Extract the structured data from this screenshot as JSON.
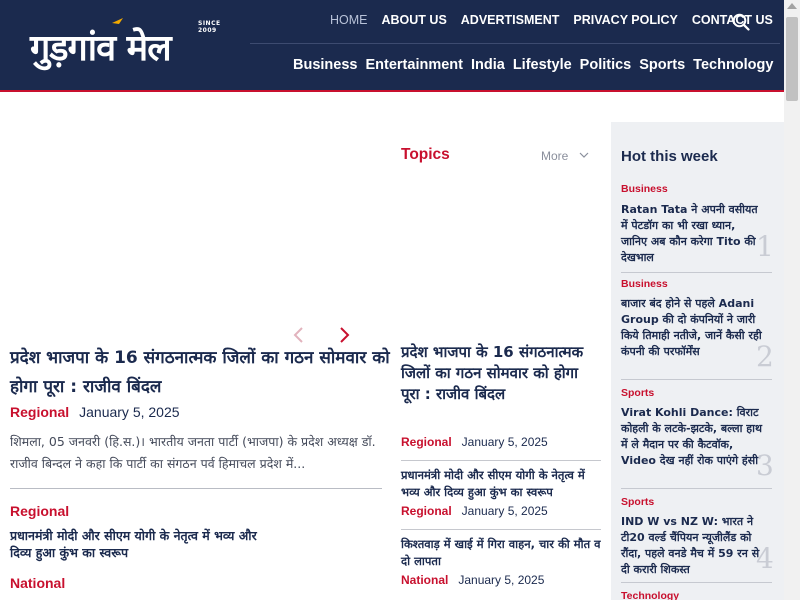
{
  "header": {
    "logo_text": "गुड़गांव मेल",
    "logo_since": "SINCE 2009",
    "top_nav": [
      {
        "label": "HOME",
        "active": true
      },
      {
        "label": "ABOUT US"
      },
      {
        "label": "ADVERTISMENT"
      },
      {
        "label": "PRIVACY POLICY"
      },
      {
        "label": "CONTACT US"
      }
    ],
    "categories": [
      "Business",
      "Entertainment",
      "India",
      "Lifestyle",
      "Politics",
      "Sports",
      "Technology"
    ],
    "search_icon": "search-icon"
  },
  "colors": {
    "header_bg": "#1b2a4e",
    "accent": "#c8102e",
    "sidebar_bg": "#eef0f3"
  },
  "main": {
    "featured": {
      "title": "प्रदेश भाजपा के 16 संगठनात्मक जिलों का गठन सोमवार को होगा पूरा : राजीव बिंदल",
      "category": "Regional",
      "date": "January 5, 2025",
      "excerpt": "शिमला, 05 जनवरी (हि.स.)। भारतीय जनता पार्टी (भाजपा) के प्रदेश अध्यक्ष डॉ. राजीव बिन्दल ने कहा कि पार्टी का संगठन पर्व हिमाचल प्रदेश में..."
    },
    "list": [
      {
        "category": "Regional",
        "title": "प्रधानमंत्री मोदी और सीएम योगी के नेतृत्व में भव्य और दिव्य हुआ कुंभ का स्वरूप"
      },
      {
        "category": "National",
        "title": ""
      }
    ]
  },
  "topics": {
    "heading": "Topics",
    "more_label": "More",
    "lead": {
      "title": "प्रदेश भाजपा के 16 संगठनात्मक जिलों का गठन सोमवार को होगा पूरा : राजीव बिंदल",
      "category": "Regional",
      "date": "January 5, 2025"
    },
    "items": [
      {
        "title": "प्रधानमंत्री मोदी और सीएम योगी के नेतृत्व में भव्य और दिव्य हुआ कुंभ का स्वरूप",
        "category": "Regional",
        "date": "January 5, 2025"
      },
      {
        "title": "किश्तवाड़ में खाई में गिरा वाहन, चार की मौत व दो लापता",
        "category": "National",
        "date": "January 5, 2025"
      }
    ]
  },
  "sidebar": {
    "heading": "Hot this week",
    "items": [
      {
        "category": "Business",
        "title": "Ratan Tata ने अपनी वसीयत में पेटडॉग का भी रखा ध्यान, जानिए अब कौन करेगा Tito की देखभाल",
        "rank": "1"
      },
      {
        "category": "Business",
        "title": "बाजार बंद होने से पहले Adani Group की दो कंपनियों ने जारी किये तिमाही नतीजे, जानें कैसी रही कंपनी की परफॉर्मेंस",
        "rank": "2"
      },
      {
        "category": "Sports",
        "title": "Virat Kohli Dance: विराट कोहली के लटके-झटके, बल्ला हाथ में ले मैदान पर की कैटवॉक, Video देख नहीं रोक पाएंगे हंसी",
        "rank": "3"
      },
      {
        "category": "Sports",
        "title": "IND W vs NZ W: भारत ने टी20 वर्ल्ड चैंपियन न्यूजीलैंड को रौंदा, पहले वनडे मैच में 59 रन से दी करारी शिकस्त",
        "rank": "4"
      },
      {
        "category": "Technology",
        "title": "",
        "rank": ""
      }
    ]
  }
}
